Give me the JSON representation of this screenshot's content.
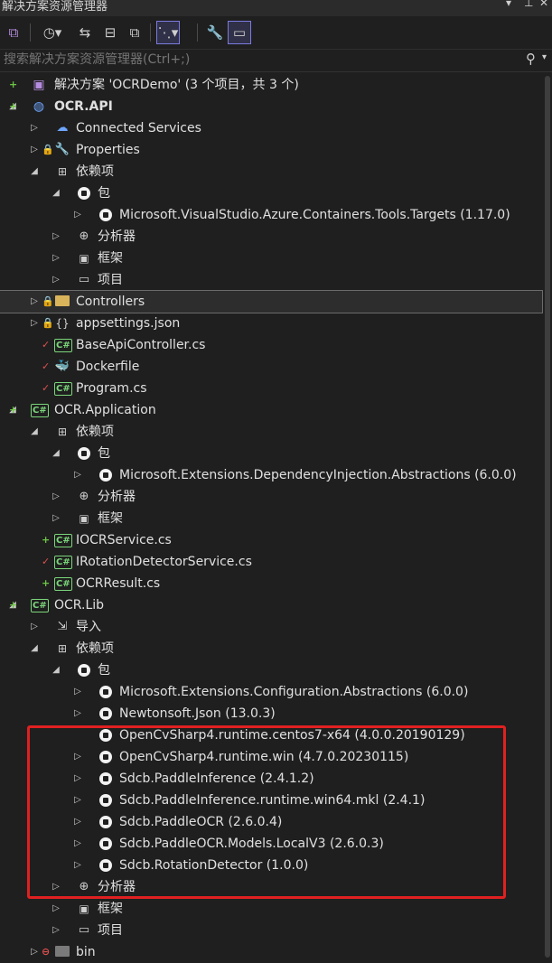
{
  "window": {
    "title": "解决方案资源管理器",
    "controls": [
      "▾",
      "⊥",
      "✕"
    ]
  },
  "toolbar": {
    "buttons": [
      {
        "name": "vs-switch-views-icon",
        "glyph": "⧉"
      },
      {
        "name": "history-icon",
        "glyph": "◷▾"
      },
      {
        "name": "sync-icon",
        "glyph": "⇆"
      },
      {
        "name": "collapse-all-icon",
        "glyph": "⊟"
      },
      {
        "name": "show-all-files-icon",
        "glyph": "⧉"
      },
      {
        "name": "filter-icon",
        "glyph": "⋱▾"
      },
      {
        "name": "properties-icon",
        "glyph": "🔧"
      },
      {
        "name": "preview-icon",
        "glyph": "▭"
      }
    ]
  },
  "search": {
    "placeholder": "搜索解决方案资源管理器(Ctrl+;)",
    "icon": "search-icon"
  },
  "tree": [
    {
      "label": "解决方案 'OCRDemo' (3 个项目，共 3 个)",
      "icon": "solution",
      "status": "+",
      "exp": "",
      "level": 0
    },
    {
      "label": "OCR.API",
      "icon": "web-project",
      "status": "+",
      "exp": "◢",
      "level": 0,
      "bold": true
    },
    {
      "label": "Connected Services",
      "icon": "connected",
      "status": "",
      "exp": "▷",
      "level": 1
    },
    {
      "label": "Properties",
      "icon": "properties",
      "status": "lock",
      "exp": "▷",
      "level": 1
    },
    {
      "label": "依赖项",
      "icon": "deps",
      "status": "",
      "exp": "◢",
      "level": 1
    },
    {
      "label": "包",
      "icon": "pkg",
      "status": "",
      "exp": "◢",
      "level": 2
    },
    {
      "label": "Microsoft.VisualStudio.Azure.Containers.Tools.Targets (1.17.0)",
      "icon": "pkg",
      "status": "",
      "exp": "▷",
      "level": 3
    },
    {
      "label": "分析器",
      "icon": "analyzer",
      "status": "",
      "exp": "▷",
      "level": 2
    },
    {
      "label": "框架",
      "icon": "framework",
      "status": "",
      "exp": "▷",
      "level": 2
    },
    {
      "label": "项目",
      "icon": "projects",
      "status": "",
      "exp": "▷",
      "level": 2
    },
    {
      "label": "Controllers",
      "icon": "folder",
      "status": "lock",
      "exp": "▷",
      "level": 1,
      "selected": true
    },
    {
      "label": "appsettings.json",
      "icon": "json",
      "status": "lock",
      "exp": "▷",
      "level": 1
    },
    {
      "label": "BaseApiController.cs",
      "icon": "cs",
      "status": "check",
      "exp": "",
      "level": 1
    },
    {
      "label": "Dockerfile",
      "icon": "docker",
      "status": "check",
      "exp": "",
      "level": 1
    },
    {
      "label": "Program.cs",
      "icon": "cs",
      "status": "check",
      "exp": "",
      "level": 1
    },
    {
      "label": "OCR.Application",
      "icon": "cs-project",
      "status": "+",
      "exp": "◢",
      "level": 0
    },
    {
      "label": "依赖项",
      "icon": "deps",
      "status": "",
      "exp": "◢",
      "level": 1
    },
    {
      "label": "包",
      "icon": "pkg",
      "status": "",
      "exp": "◢",
      "level": 2
    },
    {
      "label": "Microsoft.Extensions.DependencyInjection.Abstractions (6.0.0)",
      "icon": "pkg",
      "status": "",
      "exp": "▷",
      "level": 3
    },
    {
      "label": "分析器",
      "icon": "analyzer",
      "status": "",
      "exp": "▷",
      "level": 2
    },
    {
      "label": "框架",
      "icon": "framework",
      "status": "",
      "exp": "▷",
      "level": 2
    },
    {
      "label": "IOCRService.cs",
      "icon": "cs",
      "status": "+",
      "exp": "",
      "level": 1
    },
    {
      "label": "IRotationDetectorService.cs",
      "icon": "cs",
      "status": "check",
      "exp": "",
      "level": 1
    },
    {
      "label": "OCRResult.cs",
      "icon": "cs",
      "status": "+",
      "exp": "",
      "level": 1
    },
    {
      "label": "OCR.Lib",
      "icon": "cs-project",
      "status": "+",
      "exp": "◢",
      "level": 0
    },
    {
      "label": "导入",
      "icon": "import",
      "status": "",
      "exp": "▷",
      "level": 1
    },
    {
      "label": "依赖项",
      "icon": "deps",
      "status": "",
      "exp": "◢",
      "level": 1
    },
    {
      "label": "包",
      "icon": "pkg",
      "status": "",
      "exp": "◢",
      "level": 2
    },
    {
      "label": "Microsoft.Extensions.Configuration.Abstractions (6.0.0)",
      "icon": "pkg",
      "status": "",
      "exp": "▷",
      "level": 3
    },
    {
      "label": "Newtonsoft.Json (13.0.3)",
      "icon": "pkg",
      "status": "",
      "exp": "▷",
      "level": 3
    },
    {
      "label": "OpenCvSharp4.runtime.centos7-x64 (4.0.0.20190129)",
      "icon": "pkg",
      "status": "",
      "exp": "",
      "level": 3
    },
    {
      "label": "OpenCvSharp4.runtime.win (4.7.0.20230115)",
      "icon": "pkg",
      "status": "",
      "exp": "▷",
      "level": 3
    },
    {
      "label": "Sdcb.PaddleInference (2.4.1.2)",
      "icon": "pkg",
      "status": "",
      "exp": "▷",
      "level": 3
    },
    {
      "label": "Sdcb.PaddleInference.runtime.win64.mkl (2.4.1)",
      "icon": "pkg",
      "status": "",
      "exp": "▷",
      "level": 3
    },
    {
      "label": "Sdcb.PaddleOCR (2.6.0.4)",
      "icon": "pkg",
      "status": "",
      "exp": "▷",
      "level": 3
    },
    {
      "label": "Sdcb.PaddleOCR.Models.LocalV3 (2.6.0.3)",
      "icon": "pkg",
      "status": "",
      "exp": "▷",
      "level": 3
    },
    {
      "label": "Sdcb.RotationDetector (1.0.0)",
      "icon": "pkg",
      "status": "",
      "exp": "▷",
      "level": 3
    },
    {
      "label": "分析器",
      "icon": "analyzer",
      "status": "",
      "exp": "▷",
      "level": 2
    },
    {
      "label": "框架",
      "icon": "framework",
      "status": "",
      "exp": "▷",
      "level": 2
    },
    {
      "label": "项目",
      "icon": "projects",
      "status": "",
      "exp": "▷",
      "level": 2
    },
    {
      "label": "bin",
      "icon": "folder-dark",
      "status": "minus",
      "exp": "▷",
      "level": 1
    }
  ],
  "colors": {
    "background": "#1f1f1f",
    "text": "#e0e0e0",
    "highlight_border": "#e02020",
    "added": "#6cc644",
    "modified": "#e05050",
    "lock": "#6ea6ff"
  }
}
